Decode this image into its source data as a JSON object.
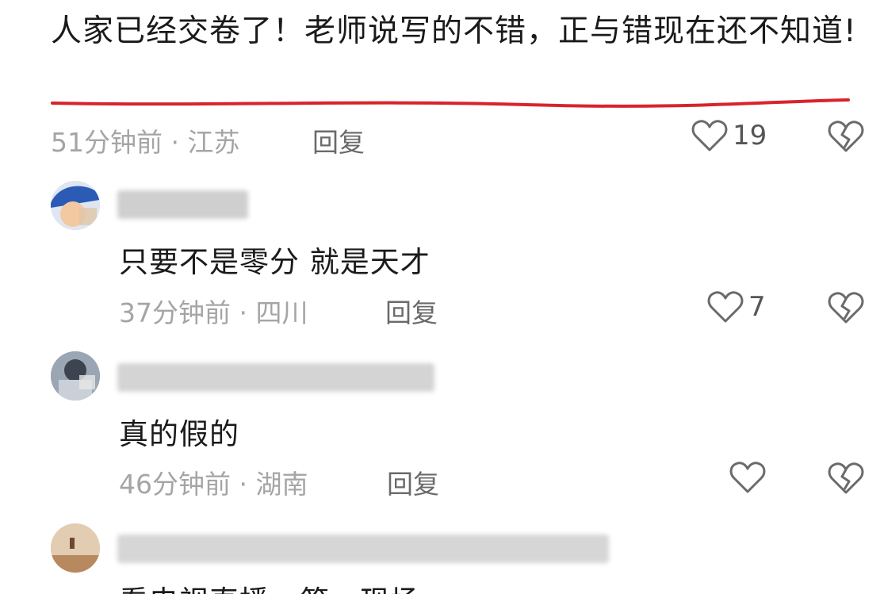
{
  "top_comment": {
    "text": "人家已经交卷了！老师说写的不错，正与错现在还不知道!",
    "time": "51分钟前 · 江苏",
    "reply_label": "回复",
    "like_count": "19"
  },
  "comments": [
    {
      "text": "只要不是零分 就是天才",
      "time": "37分钟前 · 四川",
      "reply_label": "回复",
      "like_count": "7"
    },
    {
      "text": "真的假的",
      "time": "46分钟前 · 湖南",
      "reply_label": "回复",
      "like_count": ""
    },
    {
      "text": "看电视直播，第一现场"
    }
  ],
  "colors": {
    "underline": "#d9232b",
    "text": "#1a1a1a",
    "meta": "#a5a5a5",
    "icon": "#6a6a6a"
  },
  "icons": {
    "like": "heart-outline-icon",
    "dislike": "broken-heart-icon"
  }
}
